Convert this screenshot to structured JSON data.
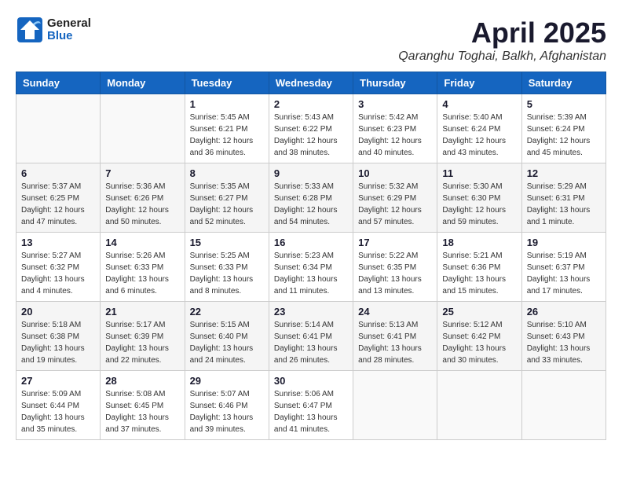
{
  "header": {
    "logo_general": "General",
    "logo_blue": "Blue",
    "month_title": "April 2025",
    "location": "Qaranghu Toghai, Balkh, Afghanistan"
  },
  "days_of_week": [
    "Sunday",
    "Monday",
    "Tuesday",
    "Wednesday",
    "Thursday",
    "Friday",
    "Saturday"
  ],
  "weeks": [
    [
      {
        "day": "",
        "detail": ""
      },
      {
        "day": "",
        "detail": ""
      },
      {
        "day": "1",
        "detail": "Sunrise: 5:45 AM\nSunset: 6:21 PM\nDaylight: 12 hours\nand 36 minutes."
      },
      {
        "day": "2",
        "detail": "Sunrise: 5:43 AM\nSunset: 6:22 PM\nDaylight: 12 hours\nand 38 minutes."
      },
      {
        "day": "3",
        "detail": "Sunrise: 5:42 AM\nSunset: 6:23 PM\nDaylight: 12 hours\nand 40 minutes."
      },
      {
        "day": "4",
        "detail": "Sunrise: 5:40 AM\nSunset: 6:24 PM\nDaylight: 12 hours\nand 43 minutes."
      },
      {
        "day": "5",
        "detail": "Sunrise: 5:39 AM\nSunset: 6:24 PM\nDaylight: 12 hours\nand 45 minutes."
      }
    ],
    [
      {
        "day": "6",
        "detail": "Sunrise: 5:37 AM\nSunset: 6:25 PM\nDaylight: 12 hours\nand 47 minutes."
      },
      {
        "day": "7",
        "detail": "Sunrise: 5:36 AM\nSunset: 6:26 PM\nDaylight: 12 hours\nand 50 minutes."
      },
      {
        "day": "8",
        "detail": "Sunrise: 5:35 AM\nSunset: 6:27 PM\nDaylight: 12 hours\nand 52 minutes."
      },
      {
        "day": "9",
        "detail": "Sunrise: 5:33 AM\nSunset: 6:28 PM\nDaylight: 12 hours\nand 54 minutes."
      },
      {
        "day": "10",
        "detail": "Sunrise: 5:32 AM\nSunset: 6:29 PM\nDaylight: 12 hours\nand 57 minutes."
      },
      {
        "day": "11",
        "detail": "Sunrise: 5:30 AM\nSunset: 6:30 PM\nDaylight: 12 hours\nand 59 minutes."
      },
      {
        "day": "12",
        "detail": "Sunrise: 5:29 AM\nSunset: 6:31 PM\nDaylight: 13 hours\nand 1 minute."
      }
    ],
    [
      {
        "day": "13",
        "detail": "Sunrise: 5:27 AM\nSunset: 6:32 PM\nDaylight: 13 hours\nand 4 minutes."
      },
      {
        "day": "14",
        "detail": "Sunrise: 5:26 AM\nSunset: 6:33 PM\nDaylight: 13 hours\nand 6 minutes."
      },
      {
        "day": "15",
        "detail": "Sunrise: 5:25 AM\nSunset: 6:33 PM\nDaylight: 13 hours\nand 8 minutes."
      },
      {
        "day": "16",
        "detail": "Sunrise: 5:23 AM\nSunset: 6:34 PM\nDaylight: 13 hours\nand 11 minutes."
      },
      {
        "day": "17",
        "detail": "Sunrise: 5:22 AM\nSunset: 6:35 PM\nDaylight: 13 hours\nand 13 minutes."
      },
      {
        "day": "18",
        "detail": "Sunrise: 5:21 AM\nSunset: 6:36 PM\nDaylight: 13 hours\nand 15 minutes."
      },
      {
        "day": "19",
        "detail": "Sunrise: 5:19 AM\nSunset: 6:37 PM\nDaylight: 13 hours\nand 17 minutes."
      }
    ],
    [
      {
        "day": "20",
        "detail": "Sunrise: 5:18 AM\nSunset: 6:38 PM\nDaylight: 13 hours\nand 19 minutes."
      },
      {
        "day": "21",
        "detail": "Sunrise: 5:17 AM\nSunset: 6:39 PM\nDaylight: 13 hours\nand 22 minutes."
      },
      {
        "day": "22",
        "detail": "Sunrise: 5:15 AM\nSunset: 6:40 PM\nDaylight: 13 hours\nand 24 minutes."
      },
      {
        "day": "23",
        "detail": "Sunrise: 5:14 AM\nSunset: 6:41 PM\nDaylight: 13 hours\nand 26 minutes."
      },
      {
        "day": "24",
        "detail": "Sunrise: 5:13 AM\nSunset: 6:41 PM\nDaylight: 13 hours\nand 28 minutes."
      },
      {
        "day": "25",
        "detail": "Sunrise: 5:12 AM\nSunset: 6:42 PM\nDaylight: 13 hours\nand 30 minutes."
      },
      {
        "day": "26",
        "detail": "Sunrise: 5:10 AM\nSunset: 6:43 PM\nDaylight: 13 hours\nand 33 minutes."
      }
    ],
    [
      {
        "day": "27",
        "detail": "Sunrise: 5:09 AM\nSunset: 6:44 PM\nDaylight: 13 hours\nand 35 minutes."
      },
      {
        "day": "28",
        "detail": "Sunrise: 5:08 AM\nSunset: 6:45 PM\nDaylight: 13 hours\nand 37 minutes."
      },
      {
        "day": "29",
        "detail": "Sunrise: 5:07 AM\nSunset: 6:46 PM\nDaylight: 13 hours\nand 39 minutes."
      },
      {
        "day": "30",
        "detail": "Sunrise: 5:06 AM\nSunset: 6:47 PM\nDaylight: 13 hours\nand 41 minutes."
      },
      {
        "day": "",
        "detail": ""
      },
      {
        "day": "",
        "detail": ""
      },
      {
        "day": "",
        "detail": ""
      }
    ]
  ]
}
